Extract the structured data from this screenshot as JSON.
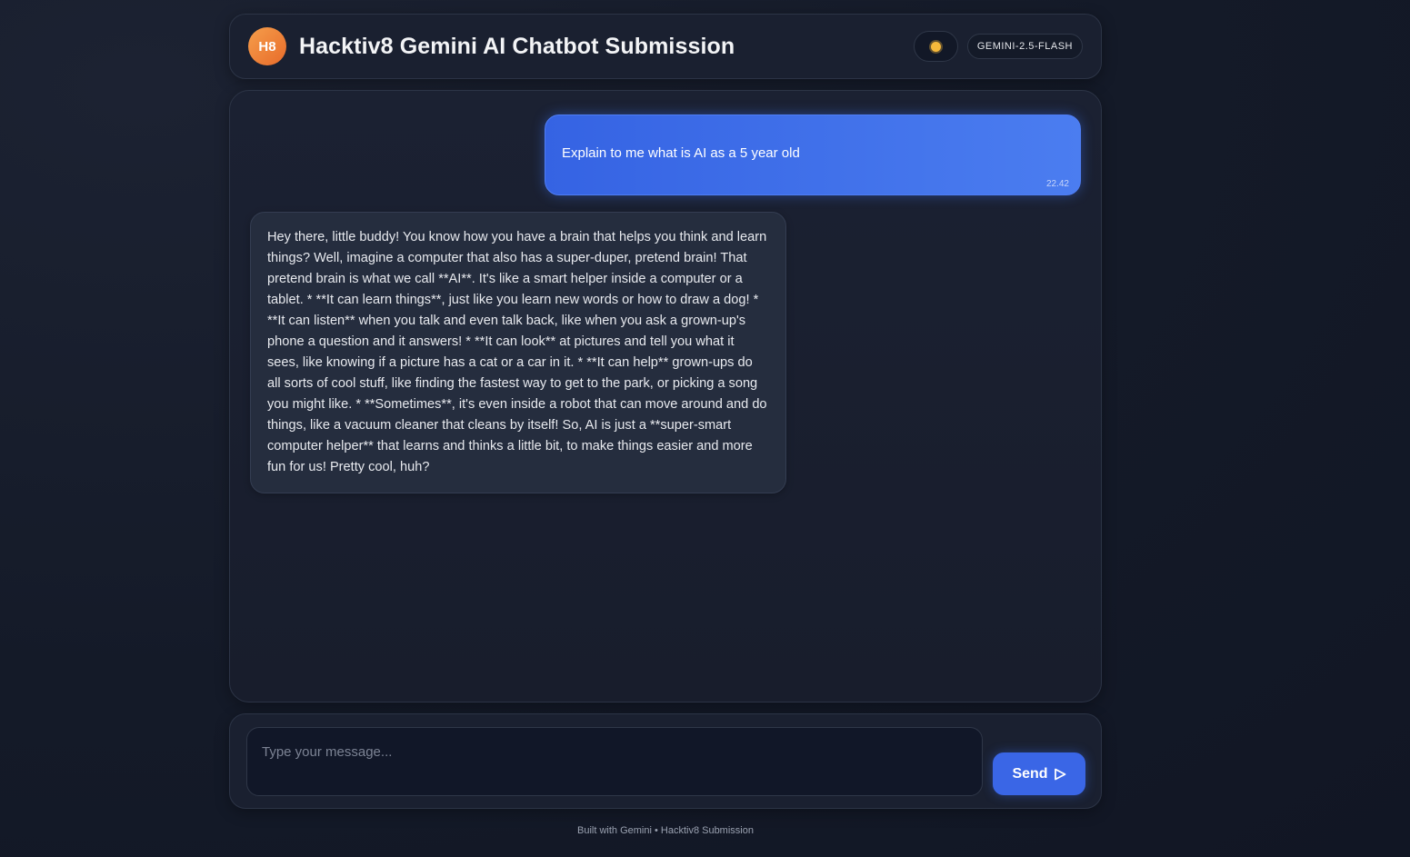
{
  "header": {
    "logo_text": "H8",
    "title": "Hacktiv8 Gemini AI Chatbot Submission",
    "theme_icon": "sun-icon",
    "model_badge": "GEMINI-2.5-FLASH"
  },
  "messages": [
    {
      "role": "user",
      "text": "Explain to me what is AI as a 5 year old",
      "time": "22.42"
    },
    {
      "role": "bot",
      "text": "Hey there, little buddy! You know how you have a brain that helps you think and learn things? Well, imagine a computer that also has a super-duper, pretend brain! That pretend brain is what we call **AI**. It's like a smart helper inside a computer or a tablet. * **It can learn things**, just like you learn new words or how to draw a dog! * **It can listen** when you talk and even talk back, like when you ask a grown-up's phone a question and it answers! * **It can look** at pictures and tell you what it sees, like knowing if a picture has a cat or a car in it. * **It can help** grown-ups do all sorts of cool stuff, like finding the fastest way to get to the park, or picking a song you might like. * **Sometimes**, it's even inside a robot that can move around and do things, like a vacuum cleaner that cleans by itself! So, AI is just a **super-smart computer helper** that learns and thinks a little bit, to make things easier and more fun for us! Pretty cool, huh?"
    }
  ],
  "composer": {
    "placeholder": "Type your message...",
    "value": "",
    "send_label": "Send",
    "send_icon": "send-arrow-icon"
  },
  "footer": {
    "text": "Built with Gemini • Hacktiv8 Submission"
  },
  "colors": {
    "accent": "#3a66e6",
    "logo": "#e86b2a"
  }
}
